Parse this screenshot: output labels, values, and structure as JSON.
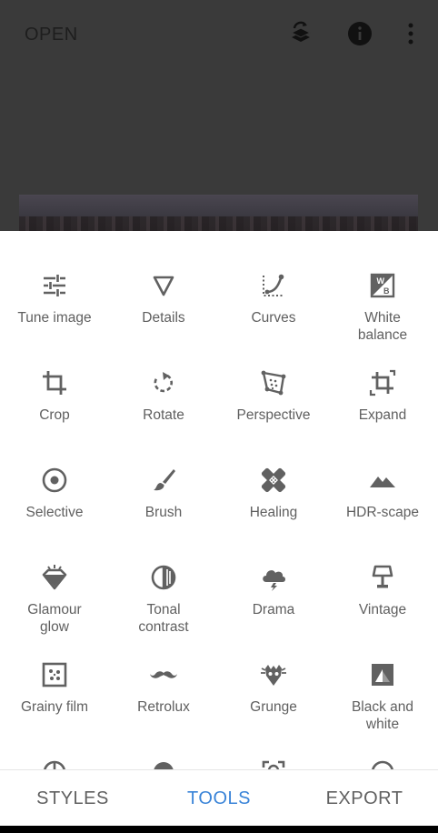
{
  "header": {
    "open_label": "OPEN",
    "icons": [
      "stack-undo-icon",
      "info-icon",
      "more-vert-icon"
    ]
  },
  "tools": [
    {
      "label": "Tune image",
      "icon": "tune-icon"
    },
    {
      "label": "Details",
      "icon": "triangle-icon"
    },
    {
      "label": "Curves",
      "icon": "curves-icon"
    },
    {
      "label": "White\nbalance",
      "icon": "white-balance-icon"
    },
    {
      "label": "Crop",
      "icon": "crop-icon"
    },
    {
      "label": "Rotate",
      "icon": "rotate-icon"
    },
    {
      "label": "Perspective",
      "icon": "perspective-icon"
    },
    {
      "label": "Expand",
      "icon": "expand-icon"
    },
    {
      "label": "Selective",
      "icon": "selective-icon"
    },
    {
      "label": "Brush",
      "icon": "brush-icon"
    },
    {
      "label": "Healing",
      "icon": "healing-icon"
    },
    {
      "label": "HDR-scape",
      "icon": "mountain-icon"
    },
    {
      "label": "Glamour\nglow",
      "icon": "diamond-icon"
    },
    {
      "label": "Tonal\ncontrast",
      "icon": "tonal-icon"
    },
    {
      "label": "Drama",
      "icon": "cloud-bolt-icon"
    },
    {
      "label": "Vintage",
      "icon": "lamp-icon"
    },
    {
      "label": "Grainy film",
      "icon": "grain-icon"
    },
    {
      "label": "Retrolux",
      "icon": "mustache-icon"
    },
    {
      "label": "Grunge",
      "icon": "grunge-icon"
    },
    {
      "label": "Black and\nwhite",
      "icon": "bw-icon"
    }
  ],
  "tabs": {
    "styles": "STYLES",
    "tools": "TOOLS",
    "export": "EXPORT",
    "active": "tools"
  },
  "colors": {
    "accent": "#3a84d8",
    "icon": "#616161",
    "label": "#5f5f5f"
  }
}
